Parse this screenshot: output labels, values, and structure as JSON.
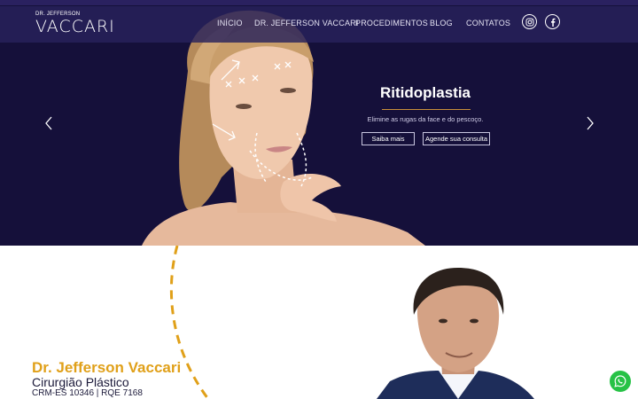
{
  "logo": {
    "small": "DR. JEFFERSON",
    "big": "VACCARI"
  },
  "nav": {
    "items": [
      "INÍCIO",
      "DR. JEFFERSON VACCARI",
      "PROCEDIMENTOS",
      "BLOG",
      "CONTATOS"
    ]
  },
  "social": {
    "instagram_icon": "instagram-icon",
    "facebook_icon": "facebook-icon"
  },
  "slide": {
    "title": "Ritidoplastia",
    "subtitle": "Elimine as rugas da face e do pescoço.",
    "primary_button": "Saiba mais",
    "secondary_button": "Agende sua consulta"
  },
  "about": {
    "name": "Dr. Jefferson Vaccari",
    "role": "Cirurgião Plástico",
    "registration": "CRM-ES 10346 | RQE 7168"
  },
  "colors": {
    "hero_bg": "#15103a",
    "accent": "#e0a019",
    "text_dark": "#1c1a3a",
    "whatsapp": "#27c246"
  }
}
